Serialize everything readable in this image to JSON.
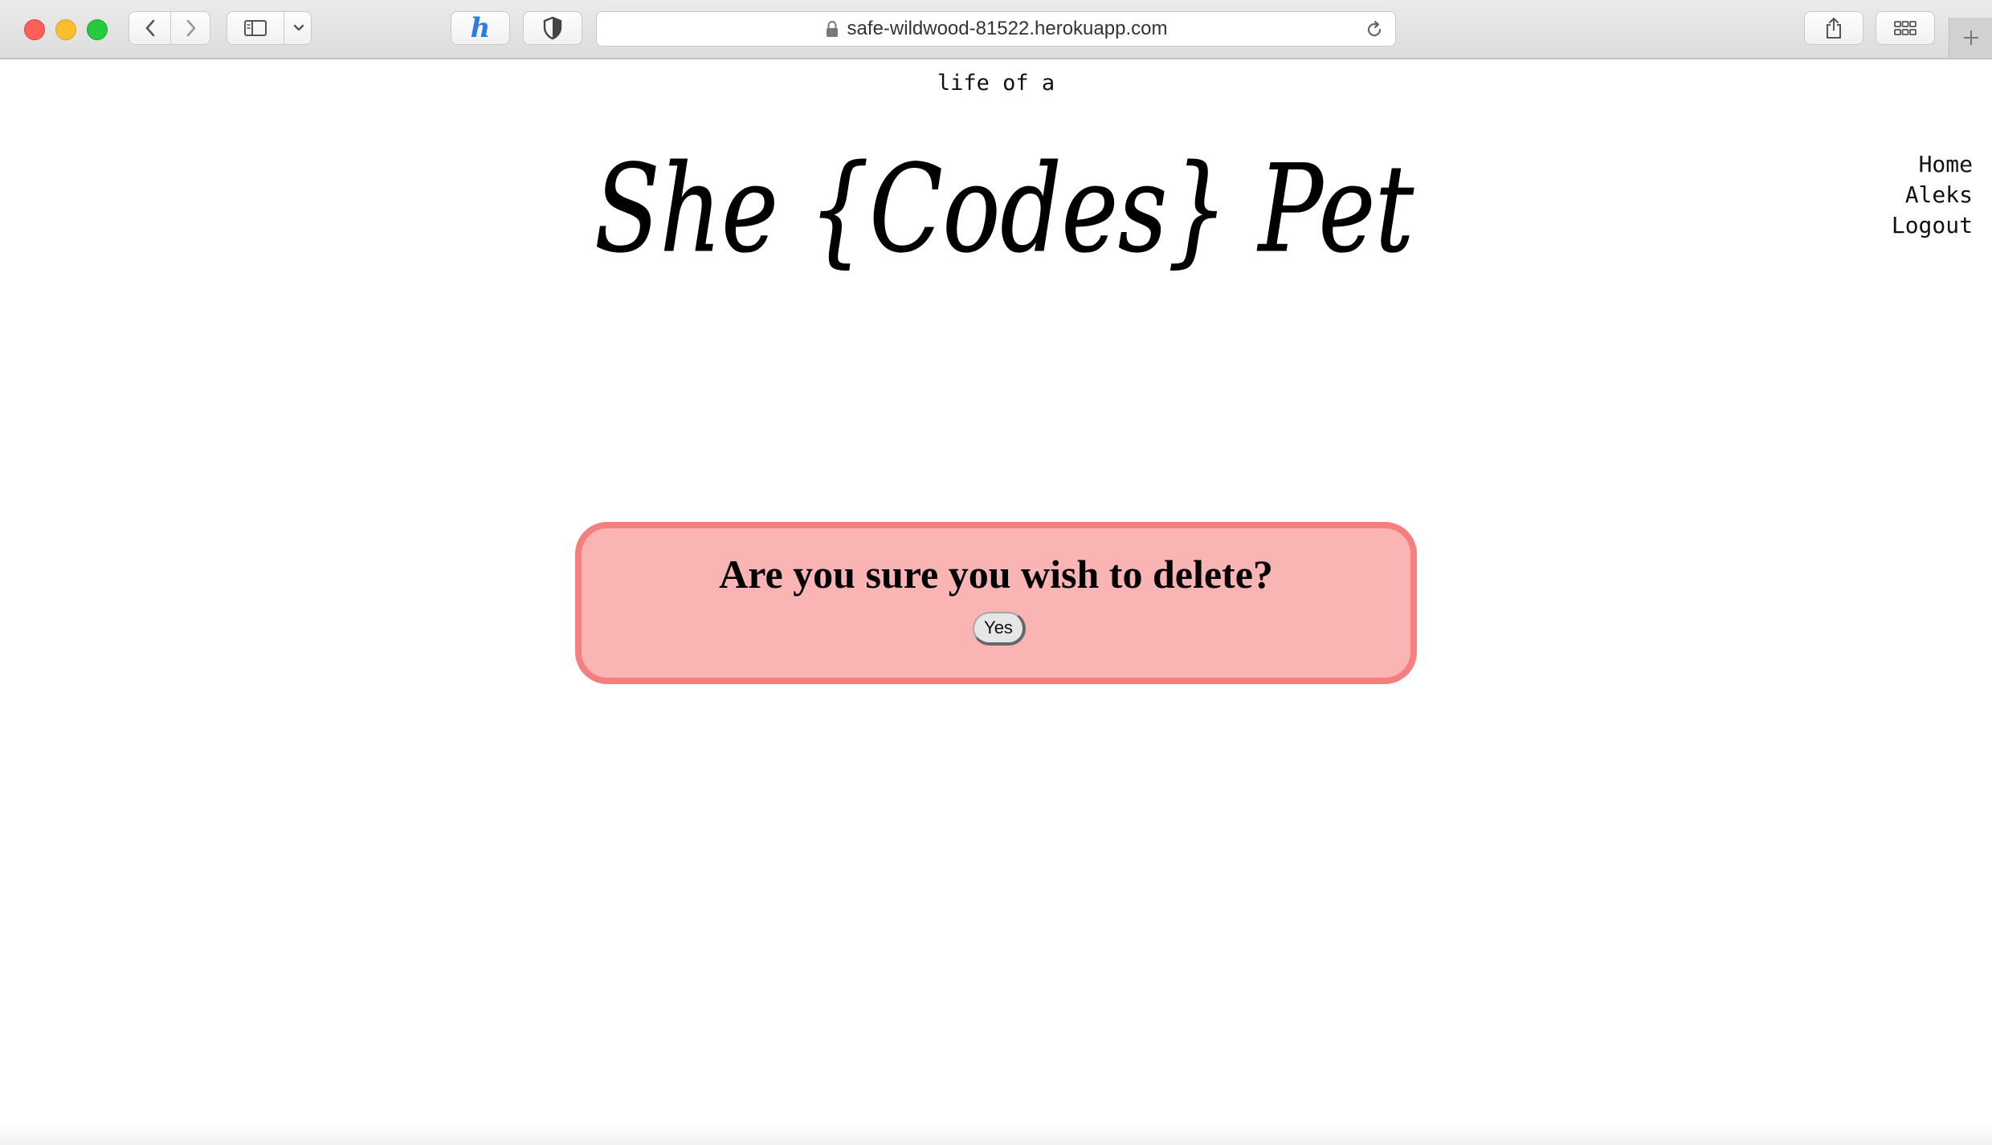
{
  "browser": {
    "url": "safe-wildwood-81522.herokuapp.com",
    "icons": [
      "back-icon",
      "forward-icon",
      "sidebar-icon",
      "chevron-down-icon",
      "honey-extension-icon",
      "shield-icon",
      "lock-icon",
      "reload-icon",
      "share-icon",
      "tab-overview-icon",
      "new-tab-icon"
    ],
    "extension_letter": "h"
  },
  "header": {
    "tagline": "life of a",
    "logo_text": "She {Codes} Pet"
  },
  "nav": {
    "items": [
      {
        "label": "Home"
      },
      {
        "label": "Aleks"
      },
      {
        "label": "Logout"
      }
    ]
  },
  "confirm": {
    "title": "Are you sure you wish to delete?",
    "yes_label": "Yes"
  },
  "colors": {
    "box_fill": "#fab4b4",
    "box_border": "#f57f7f",
    "extension_blue": "#2c7be5"
  }
}
